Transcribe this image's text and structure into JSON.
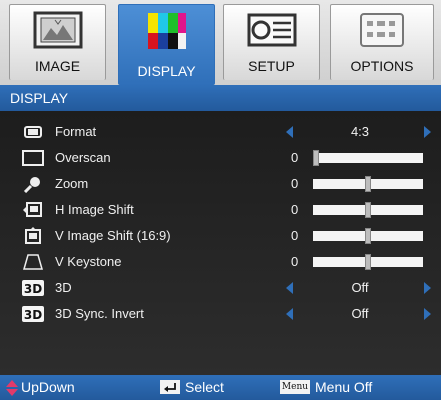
{
  "tabs": [
    {
      "label": "IMAGE",
      "icon": "image-icon",
      "active": false
    },
    {
      "label": "DISPLAY",
      "icon": "display-icon",
      "active": true
    },
    {
      "label": "SETUP",
      "icon": "setup-icon",
      "active": false
    },
    {
      "label": "OPTIONS",
      "icon": "options-icon",
      "active": false
    }
  ],
  "header": {
    "title": "DISPLAY"
  },
  "menu": [
    {
      "label": "Format",
      "icon": "format-icon",
      "type": "select",
      "value": "4:3"
    },
    {
      "label": "Overscan",
      "icon": "overscan-icon",
      "type": "slider",
      "value": "0",
      "level": 0.0
    },
    {
      "label": "Zoom",
      "icon": "zoom-icon",
      "type": "slider",
      "value": "0",
      "level": 0.5
    },
    {
      "label": "H Image Shift",
      "icon": "h-image-shift-icon",
      "type": "slider",
      "value": "0",
      "level": 0.5
    },
    {
      "label": "V Image Shift (16:9)",
      "icon": "v-image-shift-icon",
      "type": "slider",
      "value": "0",
      "level": 0.5
    },
    {
      "label": "V Keystone",
      "icon": "keystone-icon",
      "type": "slider",
      "value": "0",
      "level": 0.5
    },
    {
      "label": "3D",
      "icon": "3d-icon",
      "type": "select",
      "value": "Off"
    },
    {
      "label": "3D Sync. Invert",
      "icon": "3d-icon",
      "type": "select",
      "value": "Off"
    }
  ],
  "footer": {
    "updown": "UpDown",
    "select": "Select",
    "menu_key": "Menu",
    "menu_off": "Menu Off"
  },
  "colors": {
    "accent": "#2f6fb9",
    "menu_bg": "#1d1d1d",
    "arrow": "#2f6fb9"
  }
}
